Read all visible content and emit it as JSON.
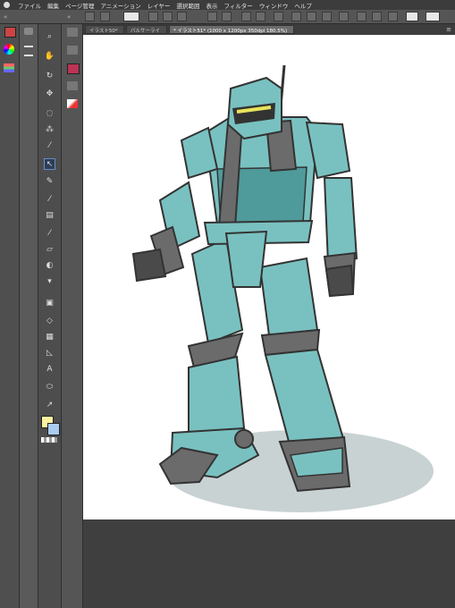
{
  "menu": {
    "items": [
      "ファイル",
      "編集",
      "ページ管理",
      "アニメーション",
      "レイヤー",
      "選択範囲",
      "表示",
      "フィルター",
      "ウィンドウ",
      "ヘルプ"
    ]
  },
  "tabs": [
    {
      "label": "イラスト50*"
    },
    {
      "label": "パルサーライ"
    },
    {
      "label": "* イラスト51* (1000 x 1200px 350dpi 180.5%)"
    }
  ],
  "tools": [
    {
      "icon": "zoom-icon"
    },
    {
      "icon": "hand-icon"
    },
    {
      "icon": "rotate-icon"
    },
    {
      "icon": "move-icon"
    },
    {
      "icon": "lasso-icon"
    },
    {
      "icon": "auto-select-icon"
    },
    {
      "icon": "eyedropper-icon"
    },
    {
      "icon": "pen-icon"
    },
    {
      "icon": "pencil-icon"
    },
    {
      "icon": "brush-icon"
    },
    {
      "icon": "airbrush-icon"
    },
    {
      "icon": "decoration-icon"
    },
    {
      "icon": "eraser-icon"
    },
    {
      "icon": "blend-icon"
    },
    {
      "icon": "fill-icon"
    },
    {
      "icon": "gradient-icon"
    },
    {
      "icon": "figure-icon"
    },
    {
      "icon": "frame-icon"
    },
    {
      "icon": "ruler-icon"
    },
    {
      "icon": "text-icon"
    },
    {
      "icon": "balloon-icon"
    },
    {
      "icon": "line-correction-icon"
    }
  ],
  "colors": {
    "main": "#fdf3a0",
    "sub": "#a9cdef",
    "robot": "#79c1c0",
    "robot_shadow": "#4f9a9b",
    "armor": "#6b6b6b",
    "visor": "#e8e35a",
    "ground": "#c9d2d3"
  }
}
